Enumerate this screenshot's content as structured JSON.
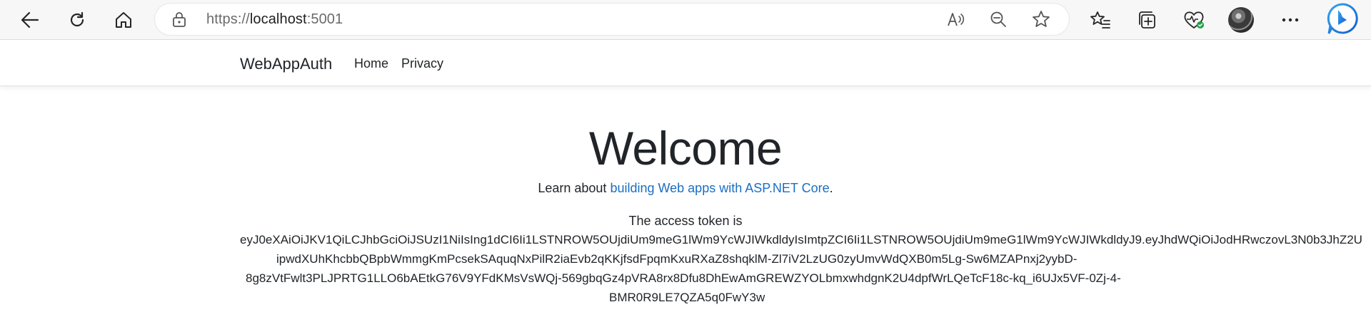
{
  "browser": {
    "url_scheme": "https://",
    "url_host": "localhost",
    "url_port": ":5001",
    "icons": {
      "back": "back-arrow-icon",
      "refresh": "refresh-icon",
      "home": "home-icon",
      "lock": "lock-icon",
      "read_aloud": "read-aloud-icon",
      "zoom_out": "zoom-out-icon",
      "favorite": "star-icon",
      "favorites": "favorites-list-icon",
      "collections": "collections-icon",
      "health": "browser-essentials-icon",
      "profile": "avatar",
      "more": "more-icon",
      "copilot": "copilot-icon"
    },
    "accent_color": "#1b6ec2"
  },
  "navbar": {
    "brand": "WebAppAuth",
    "links": [
      "Home",
      "Privacy"
    ]
  },
  "main": {
    "title": "Welcome",
    "learn_prefix": "Learn about ",
    "learn_link": "building Web apps with ASP.NET Core",
    "learn_suffix": ".",
    "token_label": "The access token is",
    "token_lines": [
      "eyJ0eXAiOiJKV1QiLCJhbGciOiJSUzI1NiIsIng1dCI6Ii1LSTNROW5OUjdiUm9meG1lWm9YcWJIWkdldyIsImtpZCI6Ii1LSTNROW5OUjdiUm9meG1lWm9YcWJIWkdldyJ9.eyJhdWQiOiJodHRwczovL3N0b3JhZ2U",
      "ipwdXUhKhcbbQBpbWmmgKmPcsekSAquqNxPilR2iaEvb2qKKjfsdFpqmKxuRXaZ8shqklM-Zl7iV2LzUG0zyUmvWdQXB0m5Lg-Sw6MZAPnxj2yybD-",
      "8g8zVtFwlt3PLJPRTG1LLO6bAEtkG76V9YFdKMsVsWQj-569gbqGz4pVRA8rx8Dfu8DhEwAmGREWZYOLbmxwhdgnK2U4dpfWrLQeTcF18c-kq_i6UJx5VF-0Zj-4-",
      "BMR0R9LE7QZA5q0FwY3w"
    ]
  }
}
